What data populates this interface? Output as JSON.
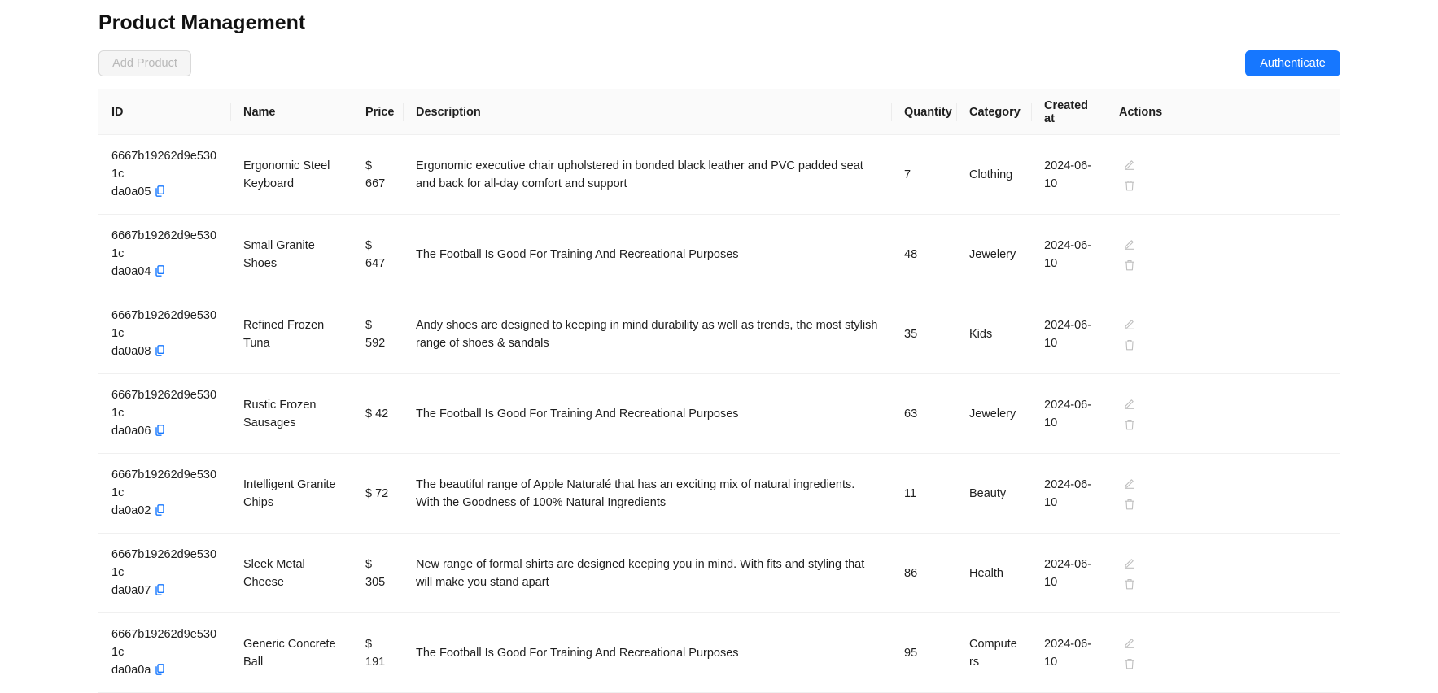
{
  "page": {
    "title": "Product Management"
  },
  "toolbar": {
    "add_label": "Add Product",
    "auth_label": "Authenticate"
  },
  "table": {
    "columns": [
      "ID",
      "Name",
      "Price",
      "Description",
      "Quantity",
      "Category",
      "Created at",
      "Actions"
    ],
    "rows": [
      {
        "id_line1": "6667b19262d9e5301c",
        "id_line2": "da0a05",
        "name": "Ergonomic Steel Keyboard",
        "price": "$ 667",
        "description": "Ergonomic executive chair upholstered in bonded black leather and PVC padded seat and back for all-day comfort and support",
        "quantity": "7",
        "category": "Clothing",
        "created_at": "2024-06-10"
      },
      {
        "id_line1": "6667b19262d9e5301c",
        "id_line2": "da0a04",
        "name": "Small Granite Shoes",
        "price": "$ 647",
        "description": "The Football Is Good For Training And Recreational Purposes",
        "quantity": "48",
        "category": "Jewelery",
        "created_at": "2024-06-10"
      },
      {
        "id_line1": "6667b19262d9e5301c",
        "id_line2": "da0a08",
        "name": "Refined Frozen Tuna",
        "price": "$ 592",
        "description": "Andy shoes are designed to keeping in mind durability as well as trends, the most stylish range of shoes & sandals",
        "quantity": "35",
        "category": "Kids",
        "created_at": "2024-06-10"
      },
      {
        "id_line1": "6667b19262d9e5301c",
        "id_line2": "da0a06",
        "name": "Rustic Frozen Sausages",
        "price": "$ 42",
        "description": "The Football Is Good For Training And Recreational Purposes",
        "quantity": "63",
        "category": "Jewelery",
        "created_at": "2024-06-10"
      },
      {
        "id_line1": "6667b19262d9e5301c",
        "id_line2": "da0a02",
        "name": "Intelligent Granite Chips",
        "price": "$ 72",
        "description": "The beautiful range of Apple Naturalé that has an exciting mix of natural ingredients. With the Goodness of 100% Natural Ingredients",
        "quantity": "11",
        "category": "Beauty",
        "created_at": "2024-06-10"
      },
      {
        "id_line1": "6667b19262d9e5301c",
        "id_line2": "da0a07",
        "name": "Sleek Metal Cheese",
        "price": "$ 305",
        "description": "New range of formal shirts are designed keeping you in mind. With fits and styling that will make you stand apart",
        "quantity": "86",
        "category": "Health",
        "created_at": "2024-06-10"
      },
      {
        "id_line1": "6667b19262d9e5301c",
        "id_line2": "da0a0a",
        "name": "Generic Concrete Ball",
        "price": "$ 191",
        "description": "The Football Is Good For Training And Recreational Purposes",
        "quantity": "95",
        "category": "Computers",
        "created_at": "2024-06-10"
      }
    ]
  },
  "icons": {
    "copy": "copy-icon",
    "edit": "edit-icon",
    "delete": "delete-icon"
  },
  "colors": {
    "primary": "#1677ff",
    "header_bg": "#fafafa",
    "border": "#f0f0f0",
    "action_icon": "#bfbfbf"
  }
}
